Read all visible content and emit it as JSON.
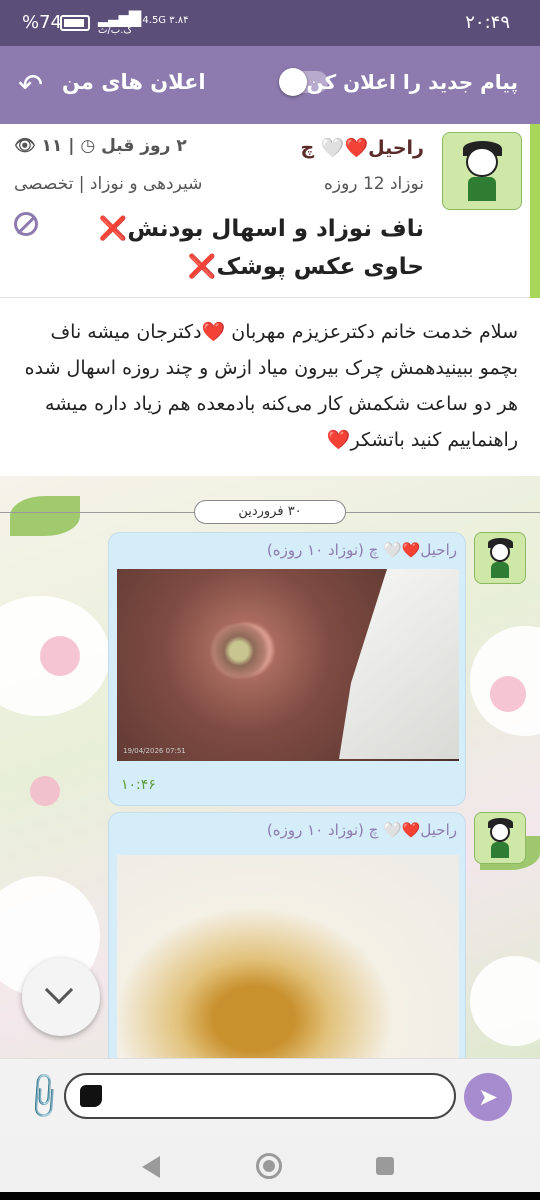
{
  "status_bar": {
    "time": "۲۰:۴۹",
    "battery": "%74",
    "net_type": "4.5G",
    "speed": "۳.۸۴",
    "speed_unit": "ک.ب/ث"
  },
  "app_bar": {
    "title": "اعلان های من",
    "notify_label": "پیام جدید را اعلان کن",
    "notify_enabled": false
  },
  "post": {
    "author": "راحیل❤️🤍 چ",
    "time_ago": "۲ روز قبل",
    "views": "۱۱",
    "baby_age": "نوزاد 12 روزه",
    "category": "شیردهی و نوزاد | تخصصی",
    "title": "ناف نوزاد و اسهال بودنش❌ حاوی عکس پوشک❌"
  },
  "question": {
    "body": "سلام خدمت خانم دکترعزیزم مهربان ❤️دکترجان میشه ناف بچمو ببینیدهمش چرک بیرون میاد ازش و چند روزه اسهال شده هر دو ساعت شکمش کار می‌کنه بادمعده هم زیاد داره میشه راهنماییم کنید باتشکر❤️"
  },
  "chat": {
    "date": "۳۰ فروردین",
    "messages": [
      {
        "author": "راحیل❤️🤍 چ (نوزاد ۱۰ روزه)",
        "photo": "navel-photo",
        "photo_stamp": "19/04/2026 07:51",
        "time": "۱۰:۴۶"
      },
      {
        "author": "راحیل❤️🤍 چ (نوزاد ۱۰ روزه)",
        "photo": "diaper-photo"
      }
    ]
  },
  "composer": {
    "placeholder": ""
  },
  "icons": {
    "back": "back-arrow-icon",
    "views": "eye-icon",
    "time": "clock-icon",
    "report": "ban-icon",
    "attach": "paperclip-icon",
    "send": "send-icon",
    "scroll": "chevron-down-icon"
  },
  "colors": {
    "status_bar": "#5b4e79",
    "app_bar": "#8d7baf",
    "accent_green": "#a7d65a",
    "bubble": "#d5ecf9",
    "send_button": "#a78bcf"
  }
}
